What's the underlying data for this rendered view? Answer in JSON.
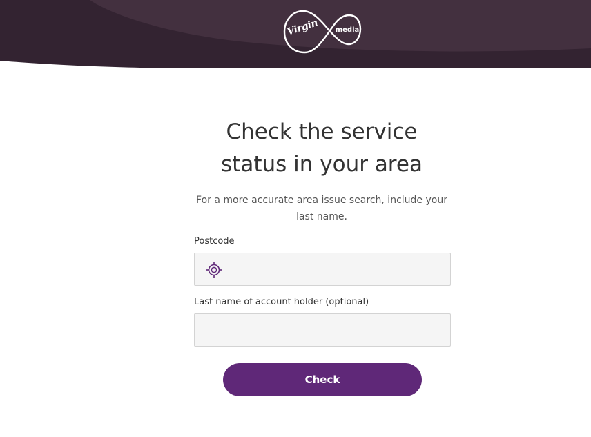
{
  "header": {
    "logo": {
      "brand_text": "Virgin",
      "product_text": "media",
      "icon": "virgin-media-infinity-logo"
    },
    "colors": {
      "band_dark": "#332331",
      "band_light": "#43303f"
    }
  },
  "main": {
    "title_line1": "Check the service",
    "title_line2": "status in your area",
    "subtitle_line1": "For a more accurate area issue search, include your",
    "subtitle_line2": "last name.",
    "postcode": {
      "label": "Postcode",
      "value": "",
      "placeholder": "",
      "icon": "locate-icon"
    },
    "last_name": {
      "label": "Last name of account holder (optional)",
      "value": "",
      "placeholder": ""
    },
    "check_button_label": "Check"
  },
  "colors": {
    "accent": "#5f2878",
    "field_background": "#f5f5f5",
    "field_border": "#d3d3d3",
    "text": "#333333"
  }
}
